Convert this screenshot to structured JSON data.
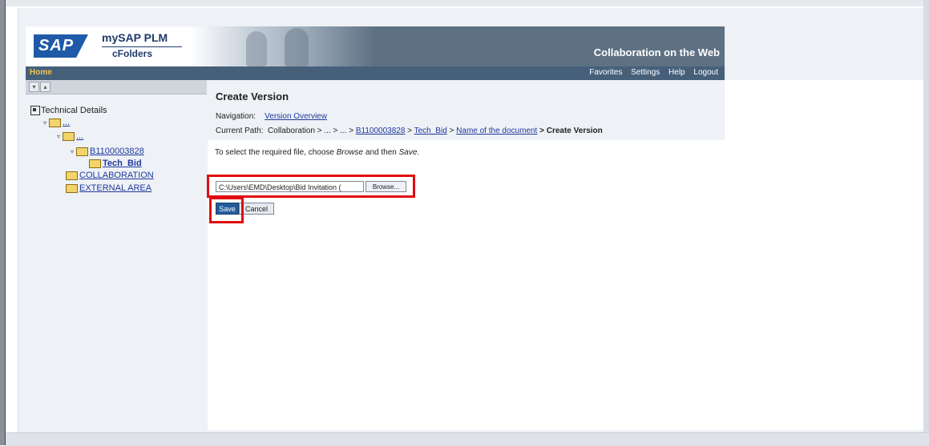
{
  "header": {
    "logo_text": "SAP",
    "product_name": "mySAP PLM",
    "product_sub": "cFolders",
    "tagline": "Collaboration on the Web"
  },
  "navbar": {
    "home": "Home",
    "links": [
      "Favorites",
      "Settings",
      "Help",
      "Logout"
    ]
  },
  "sidebar": {
    "root_label": "Technical Details",
    "nodes": [
      "...",
      "...",
      "B1100003828",
      "Tech_Bid",
      "COLLABORATION",
      "EXTERNAL AREA"
    ]
  },
  "main": {
    "title": "Create Version",
    "navigation_label": "Navigation:",
    "navigation_link": "Version Overview",
    "path_label": "Current Path:",
    "path_start": "Collaboration > ... > ... >",
    "path_link1": "B1100003828",
    "path_sep1": ">",
    "path_link2": "Tech_Bid",
    "path_sep2": ">",
    "path_link3": "Name of the document",
    "path_end": "> Create Version",
    "instruction_pre": "To select the required file, choose ",
    "instruction_browse": "Browse",
    "instruction_mid": " and then ",
    "instruction_save": "Save",
    "instruction_post": ".",
    "file_value": "C:\\Users\\EMD\\Desktop\\Bid Invitation (",
    "browse_label": "Browse...",
    "save_label": "Save",
    "cancel_label": "Cancel"
  },
  "colors": {
    "highlight": "#e10b12",
    "header_bg": "#5e7183",
    "link": "#1f3a9e"
  }
}
